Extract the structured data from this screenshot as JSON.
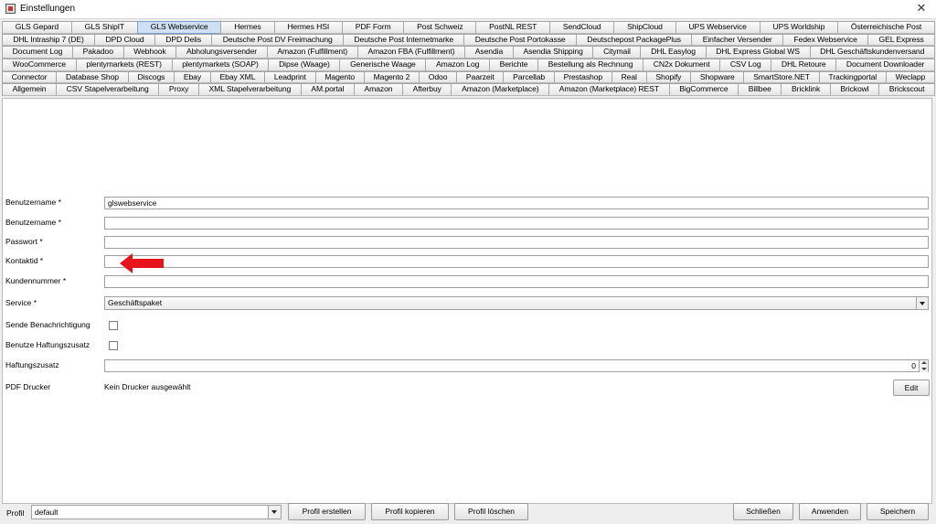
{
  "window": {
    "title": "Einstellungen",
    "close_symbol": "✕"
  },
  "tabs": {
    "rows": [
      [
        "GLS Gepard",
        "GLS ShipIT",
        "GLS Webservice",
        "Hermes",
        "Hermes HSI",
        "PDF Form",
        "Post Schweiz",
        "PostNL REST",
        "SendCloud",
        "ShipCloud",
        "UPS Webservice",
        "UPS Worldship",
        "Österreichische Post"
      ],
      [
        "DHL Intraship 7 (DE)",
        "DPD Cloud",
        "DPD Delis",
        "Deutsche Post DV Freimachung",
        "Deutsche Post Internetmarke",
        "Deutsche Post Portokasse",
        "Deutschepost PackagePlus",
        "Einfacher Versender",
        "Fedex Webservice",
        "GEL Express"
      ],
      [
        "Document Log",
        "Pakadoo",
        "Webhook",
        "Abholungsversender",
        "Amazon (Fulfillment)",
        "Amazon FBA (Fulfillment)",
        "Asendia",
        "Asendia Shipping",
        "Citymail",
        "DHL Easylog",
        "DHL Express Global WS",
        "DHL Geschäftskundenversand"
      ],
      [
        "WooCommerce",
        "plentymarkets (REST)",
        "plentymarkets (SOAP)",
        "Dipse (Waage)",
        "Generische Waage",
        "Amazon Log",
        "Berichte",
        "Bestellung als Rechnung",
        "CN2x Dokument",
        "CSV Log",
        "DHL Retoure",
        "Document Downloader"
      ],
      [
        "Connector",
        "Database Shop",
        "Discogs",
        "Ebay",
        "Ebay XML",
        "Leadprint",
        "Magento",
        "Magento 2",
        "Odoo",
        "Paarzeit",
        "Parcellab",
        "Prestashop",
        "Real",
        "Shopify",
        "Shopware",
        "SmartStore.NET",
        "Trackingportal",
        "Weclapp"
      ],
      [
        "Allgemein",
        "CSV Stapelverarbeitung",
        "Proxy",
        "XML Stapelverarbeitung",
        "AM.portal",
        "Amazon",
        "Afterbuy",
        "Amazon (Marketplace)",
        "Amazon (Marketplace) REST",
        "BigCommerce",
        "Billbee",
        "Bricklink",
        "Brickowl",
        "Brickscout"
      ]
    ],
    "active": "GLS Webservice"
  },
  "form": {
    "benutzername1": {
      "label": "Benutzername *",
      "value": "glswebservice"
    },
    "benutzername2": {
      "label": "Benutzername *",
      "value": ""
    },
    "passwort": {
      "label": "Passwort *",
      "value": ""
    },
    "kontaktid": {
      "label": "Kontaktid *",
      "value": ""
    },
    "kundennummer": {
      "label": "Kundennummer *",
      "value": ""
    },
    "service": {
      "label": "Service *",
      "value": "Geschäftspaket"
    },
    "sende_benachrichtigung": {
      "label": "Sende Benachrichtigung",
      "checked": false
    },
    "benutze_haftungszusatz": {
      "label": "Benutze Haftungszusatz",
      "checked": false
    },
    "haftungszusatz": {
      "label": "Haftungszusatz",
      "value": "0"
    },
    "pdf_drucker": {
      "label": "PDF Drucker",
      "value": "Kein Drucker ausgewählt",
      "edit_label": "Edit"
    }
  },
  "annotation": {
    "arrow_color": "#e8141b"
  },
  "bottom": {
    "profil_label": "Profil",
    "profil_value": "default",
    "buttons": {
      "create": "Profil erstellen",
      "copy": "Profil kopieren",
      "delete": "Profil löschen",
      "close": "Schließen",
      "apply": "Anwenden",
      "save": "Speichern"
    }
  }
}
